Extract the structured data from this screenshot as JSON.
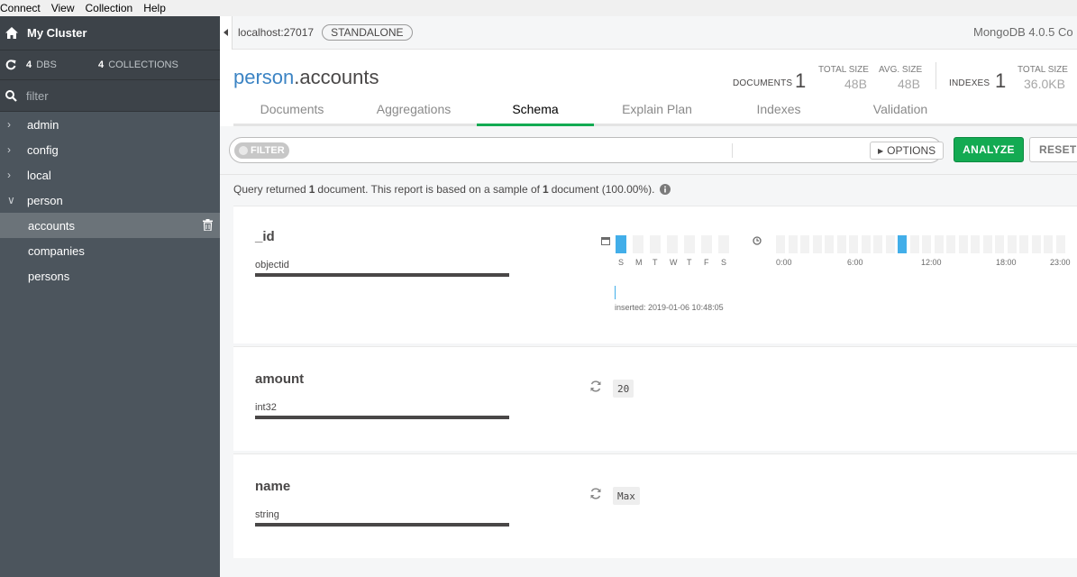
{
  "menu": [
    "Connect",
    "View",
    "Collection",
    "Help"
  ],
  "sidebar": {
    "cluster_name": "My Cluster",
    "dbs_count": "4",
    "dbs_label": "DBS",
    "collections_count": "4",
    "collections_label": "COLLECTIONS",
    "filter_placeholder": "filter",
    "databases": [
      {
        "name": "admin",
        "expanded": false
      },
      {
        "name": "config",
        "expanded": false
      },
      {
        "name": "local",
        "expanded": false
      },
      {
        "name": "person",
        "expanded": true,
        "collections": [
          "accounts",
          "companies",
          "persons"
        ],
        "active": "accounts"
      }
    ]
  },
  "topbar": {
    "host": "localhost:27017",
    "badge": "STANDALONE",
    "version": "MongoDB 4.0.5 Co"
  },
  "header": {
    "db": "person",
    "collection": ".accounts",
    "documents_label": "DOCUMENTS",
    "documents_value": "1",
    "total_size_label": "TOTAL SIZE",
    "total_size_value": "48B",
    "avg_size_label": "AVG. SIZE",
    "avg_size_value": "48B",
    "indexes_label": "INDEXES",
    "indexes_value": "1",
    "idx_total_size_label": "TOTAL SIZE",
    "idx_total_size_value": "36.0KB"
  },
  "tabs": [
    "Documents",
    "Aggregations",
    "Schema",
    "Explain Plan",
    "Indexes",
    "Validation"
  ],
  "active_tab": "Schema",
  "query": {
    "filter_label": "FILTER",
    "options_label": "OPTIONS",
    "analyze_label": "ANALYZE",
    "reset_label": "RESET"
  },
  "summary": {
    "prefix": "Query returned",
    "count": "1",
    "middle": "document. This report is based on a sample of",
    "sample": "1",
    "suffix": "document (100.00%)."
  },
  "fields": [
    {
      "name": "_id",
      "type": "objectid",
      "weekdays": [
        "S",
        "M",
        "T",
        "W",
        "T",
        "F",
        "S"
      ],
      "active_weekday": 0,
      "hour_labels": [
        "0:00",
        "6:00",
        "12:00",
        "18:00",
        "23:00"
      ],
      "active_hour": 10,
      "inserted": "inserted: 2019-01-06 10:48:05"
    },
    {
      "name": "amount",
      "type": "int32",
      "sample": "20"
    },
    {
      "name": "name",
      "type": "string",
      "sample": "Max"
    }
  ],
  "colors": {
    "sidebar_bg": "#4c555d",
    "accent_green": "#13aa52",
    "db_blue": "#3c84c4",
    "chart_blue": "#42aee9"
  }
}
